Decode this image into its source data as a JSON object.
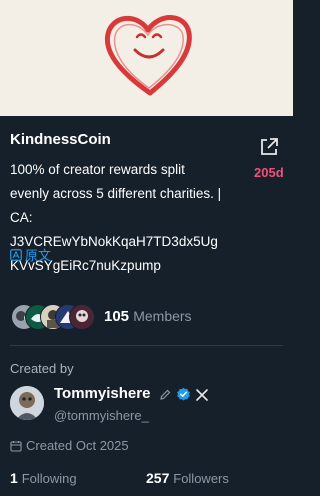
{
  "coin": {
    "name": "KindnessCoin",
    "age": "205d",
    "description_lines": [
      "100% of creator rewards split",
      "evenly across 5 different charities. |",
      "CA:",
      "J3VCREwYbNokKqaH7TD3dx5Ug",
      "KVvSYgEiRc7nuKzpump"
    ],
    "translate_label": "原文",
    "share_icon": "share-icon",
    "banner_icon": "heart-smiley-drawing"
  },
  "members": {
    "count": "105",
    "label": "Members"
  },
  "creator": {
    "heading": "Created by",
    "name": "Tommyishere",
    "handle": "@tommyishere_",
    "created": "Created Oct 2025",
    "following_count": "1",
    "following_label": "Following",
    "followers_count": "257",
    "followers_label": "Followers"
  },
  "colors": {
    "background": "#16202a",
    "accent_age": "#f0507a",
    "link": "#1d9bf0",
    "verified": "#1d9bf0",
    "heart": "#d83a3a"
  }
}
